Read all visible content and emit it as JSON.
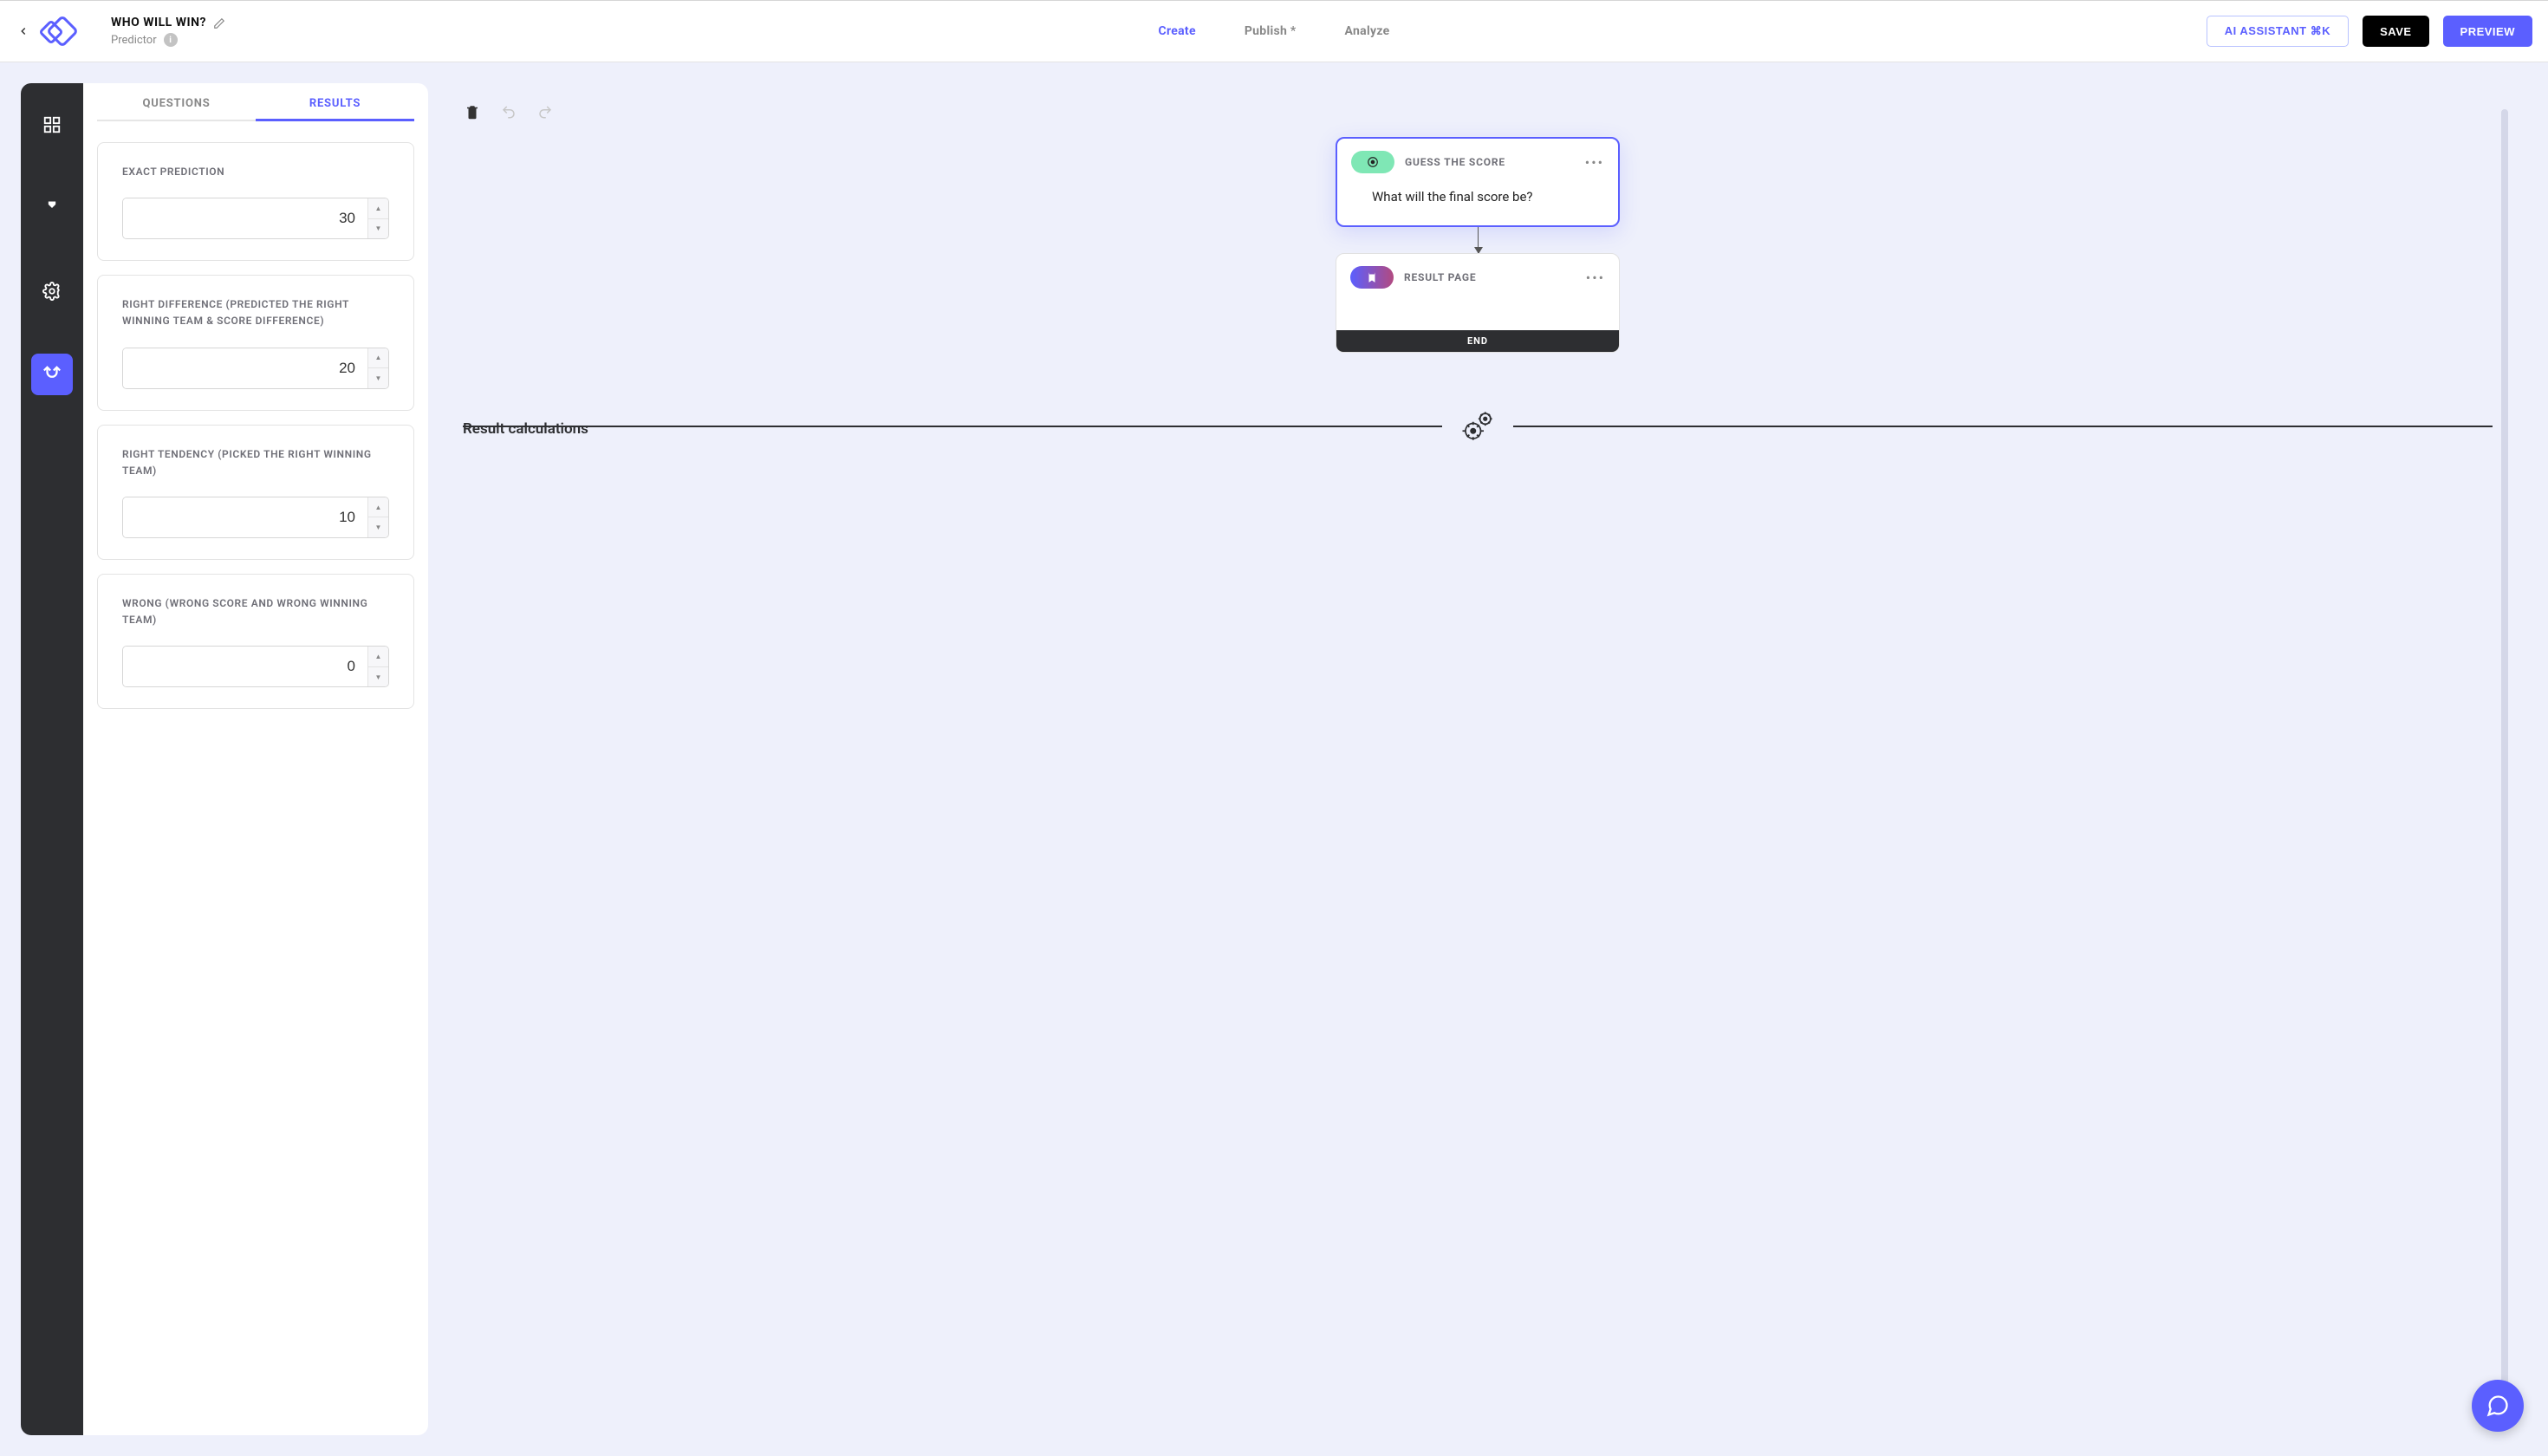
{
  "header": {
    "title": "WHO WILL WIN?",
    "subtitle": "Predictor",
    "nav": [
      {
        "label": "Create",
        "active": true
      },
      {
        "label": "Publish *",
        "active": false
      },
      {
        "label": "Analyze",
        "active": false
      }
    ],
    "ai_button": "AI ASSISTANT  ⌘K",
    "save_button": "SAVE",
    "preview_button": "PREVIEW"
  },
  "side_tabs": {
    "questions": "QUESTIONS",
    "results": "RESULTS"
  },
  "scores": [
    {
      "label": "EXACT PREDICTION",
      "value": "30"
    },
    {
      "label": "RIGHT DIFFERENCE (PREDICTED THE RIGHT WINNING TEAM & SCORE DIFFERENCE)",
      "value": "20"
    },
    {
      "label": "RIGHT TENDENCY (PICKED THE RIGHT WINNING TEAM)",
      "value": "10"
    },
    {
      "label": "WRONG (WRONG SCORE AND WRONG WINNING TEAM)",
      "value": "0"
    }
  ],
  "flow": {
    "node1_title": "GUESS THE SCORE",
    "node1_body": "What will the final score be?",
    "node2_title": "RESULT PAGE",
    "end_label": "END"
  },
  "calc_label": "Result calculations"
}
